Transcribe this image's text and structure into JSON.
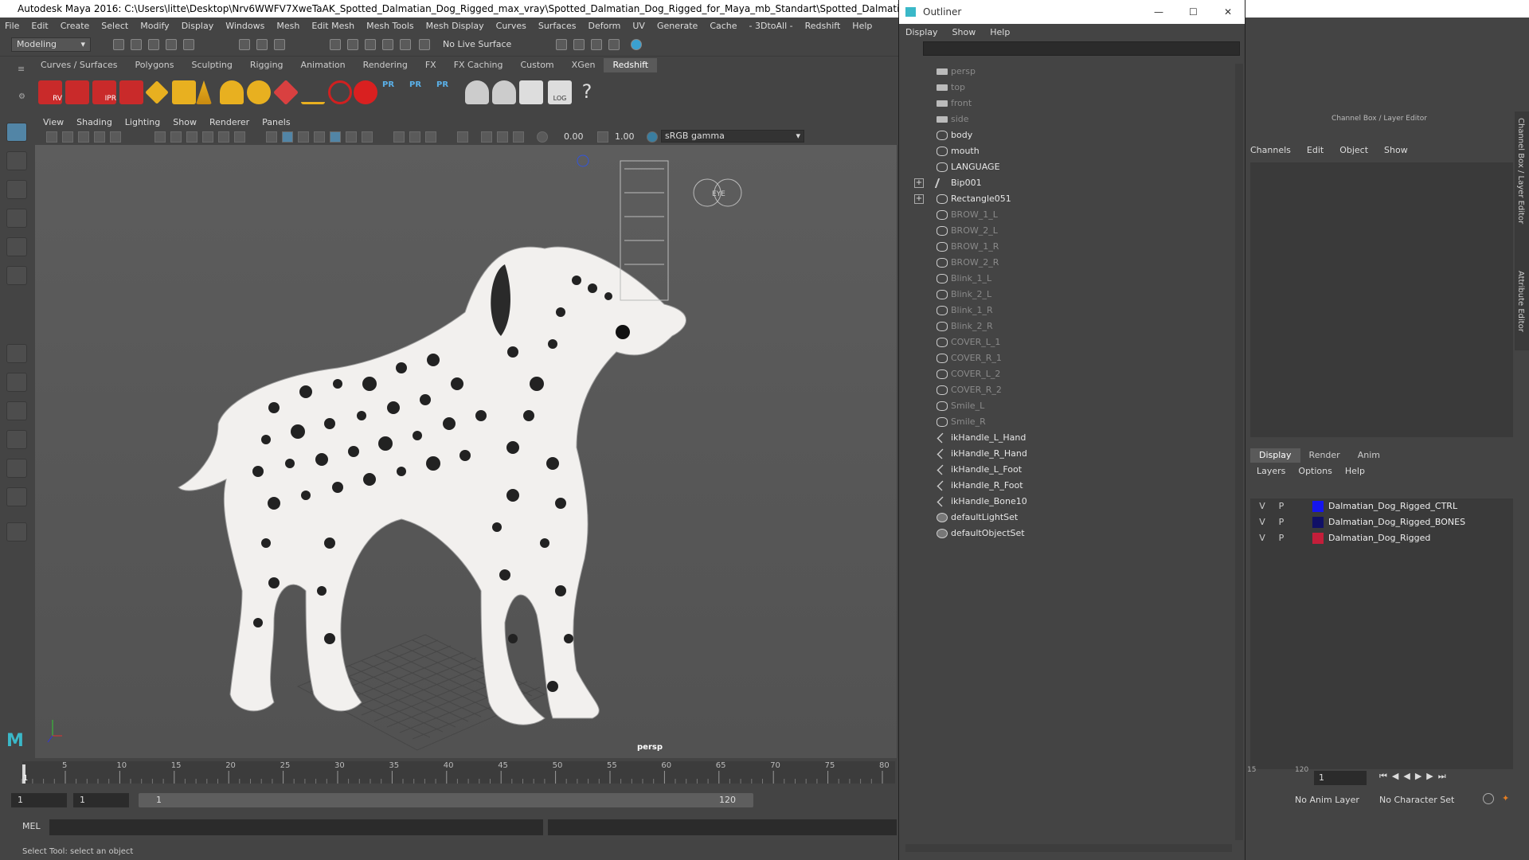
{
  "window": {
    "title": "Autodesk Maya 2016: C:\\Users\\litte\\Desktop\\Nrv6WWFV7XweTaAK_Spotted_Dalmatian_Dog_Rigged_max_vray\\Spotted_Dalmatian_Dog_Rigged_for_Maya_mb_Standart\\Spotted_Dalmatian_Dog_Rigged_for_Maya"
  },
  "menubar": [
    "File",
    "Edit",
    "Create",
    "Select",
    "Modify",
    "Display",
    "Windows",
    "Mesh",
    "Edit Mesh",
    "Mesh Tools",
    "Mesh Display",
    "Curves",
    "Surfaces",
    "Deform",
    "UV",
    "Generate",
    "Cache",
    "- 3DtoAll -",
    "Redshift",
    "Help"
  ],
  "status": {
    "mode": "Modeling",
    "live_surface": "No Live Surface"
  },
  "shelf_tabs": [
    "Curves / Surfaces",
    "Polygons",
    "Sculpting",
    "Rigging",
    "Animation",
    "Rendering",
    "FX",
    "FX Caching",
    "Custom",
    "XGen",
    "Redshift"
  ],
  "shelf_active": "Redshift",
  "shelf_labels": {
    "rv": "RV",
    "ipr": "IPR",
    "pr1": "PR",
    "pr2": "PR",
    "pr3": "PR",
    "log": "LOG",
    "help": "?"
  },
  "viewport": {
    "menu": [
      "View",
      "Shading",
      "Lighting",
      "Show",
      "Renderer",
      "Panels"
    ],
    "exposure": "0.00",
    "gamma": "1.00",
    "colorspace": "sRGB gamma",
    "camera": "persp",
    "eye_label": "EYE"
  },
  "timeline": {
    "ticks": [
      "5",
      "10",
      "15",
      "20",
      "25",
      "30",
      "35",
      "40",
      "45",
      "50",
      "55",
      "60",
      "65",
      "70",
      "75",
      "80"
    ],
    "current": "1"
  },
  "range": {
    "start": "1",
    "start2": "1",
    "inner_start": "1",
    "inner_end": "120"
  },
  "right_timeline": {
    "t1": "15",
    "t2": "120",
    "frame": "1"
  },
  "cmd": {
    "label": "MEL"
  },
  "help": "Select Tool: select an object",
  "outliner": {
    "title": "Outliner",
    "menu": [
      "Display",
      "Show",
      "Help"
    ],
    "items": [
      {
        "name": "persp",
        "type": "camera",
        "dim": true
      },
      {
        "name": "top",
        "type": "camera",
        "dim": true
      },
      {
        "name": "front",
        "type": "camera",
        "dim": true
      },
      {
        "name": "side",
        "type": "camera",
        "dim": true
      },
      {
        "name": "body",
        "type": "mesh",
        "dim": false
      },
      {
        "name": "mouth",
        "type": "mesh",
        "dim": false
      },
      {
        "name": "LANGUAGE",
        "type": "mesh",
        "dim": false
      },
      {
        "name": "Bip001",
        "type": "joint",
        "dim": false,
        "expand": true
      },
      {
        "name": "Rectangle051",
        "type": "mesh",
        "dim": false,
        "expand": true
      },
      {
        "name": "BROW_1_L",
        "type": "mesh",
        "dim": true
      },
      {
        "name": "BROW_2_L",
        "type": "mesh",
        "dim": true
      },
      {
        "name": "BROW_1_R",
        "type": "mesh",
        "dim": true
      },
      {
        "name": "BROW_2_R",
        "type": "mesh",
        "dim": true
      },
      {
        "name": "Blink_1_L",
        "type": "mesh",
        "dim": true
      },
      {
        "name": "Blink_2_L",
        "type": "mesh",
        "dim": true
      },
      {
        "name": "Blink_1_R",
        "type": "mesh",
        "dim": true
      },
      {
        "name": "Blink_2_R",
        "type": "mesh",
        "dim": true
      },
      {
        "name": "COVER_L_1",
        "type": "mesh",
        "dim": true
      },
      {
        "name": "COVER_R_1",
        "type": "mesh",
        "dim": true
      },
      {
        "name": "COVER_L_2",
        "type": "mesh",
        "dim": true
      },
      {
        "name": "COVER_R_2",
        "type": "mesh",
        "dim": true
      },
      {
        "name": "Smile_L",
        "type": "mesh",
        "dim": true
      },
      {
        "name": "Smile_R",
        "type": "mesh",
        "dim": true
      },
      {
        "name": "ikHandle_L_Hand",
        "type": "ik",
        "dim": false
      },
      {
        "name": "ikHandle_R_Hand",
        "type": "ik",
        "dim": false
      },
      {
        "name": "ikHandle_L_Foot",
        "type": "ik",
        "dim": false
      },
      {
        "name": "ikHandle_R_Foot",
        "type": "ik",
        "dim": false
      },
      {
        "name": "ikHandle_Bone10",
        "type": "ik",
        "dim": false
      },
      {
        "name": "defaultLightSet",
        "type": "set",
        "dim": false
      },
      {
        "name": "defaultObjectSet",
        "type": "set",
        "dim": false
      }
    ]
  },
  "channel_box": {
    "title": "Channel Box / Layer Editor",
    "menu": [
      "Channels",
      "Edit",
      "Object",
      "Show"
    ]
  },
  "layer_editor": {
    "tabs": [
      "Display",
      "Render",
      "Anim"
    ],
    "active": "Display",
    "menu": [
      "Layers",
      "Options",
      "Help"
    ],
    "layers": [
      {
        "v": "V",
        "p": "P",
        "color": "#1515ee",
        "name": "Dalmatian_Dog_Rigged_CTRL"
      },
      {
        "v": "V",
        "p": "P",
        "color": "#101066",
        "name": "Dalmatian_Dog_Rigged_BONES"
      },
      {
        "v": "V",
        "p": "P",
        "color": "#c41e3a",
        "name": "Dalmatian_Dog_Rigged"
      }
    ]
  },
  "side_tabs": [
    "Channel Box / Layer Editor",
    "Attribute Editor"
  ],
  "anim": {
    "anim_layer": "No Anim Layer",
    "char_set": "No Character Set"
  },
  "colors": {
    "ui_bg": "#444444",
    "accent": "#5285a6"
  }
}
